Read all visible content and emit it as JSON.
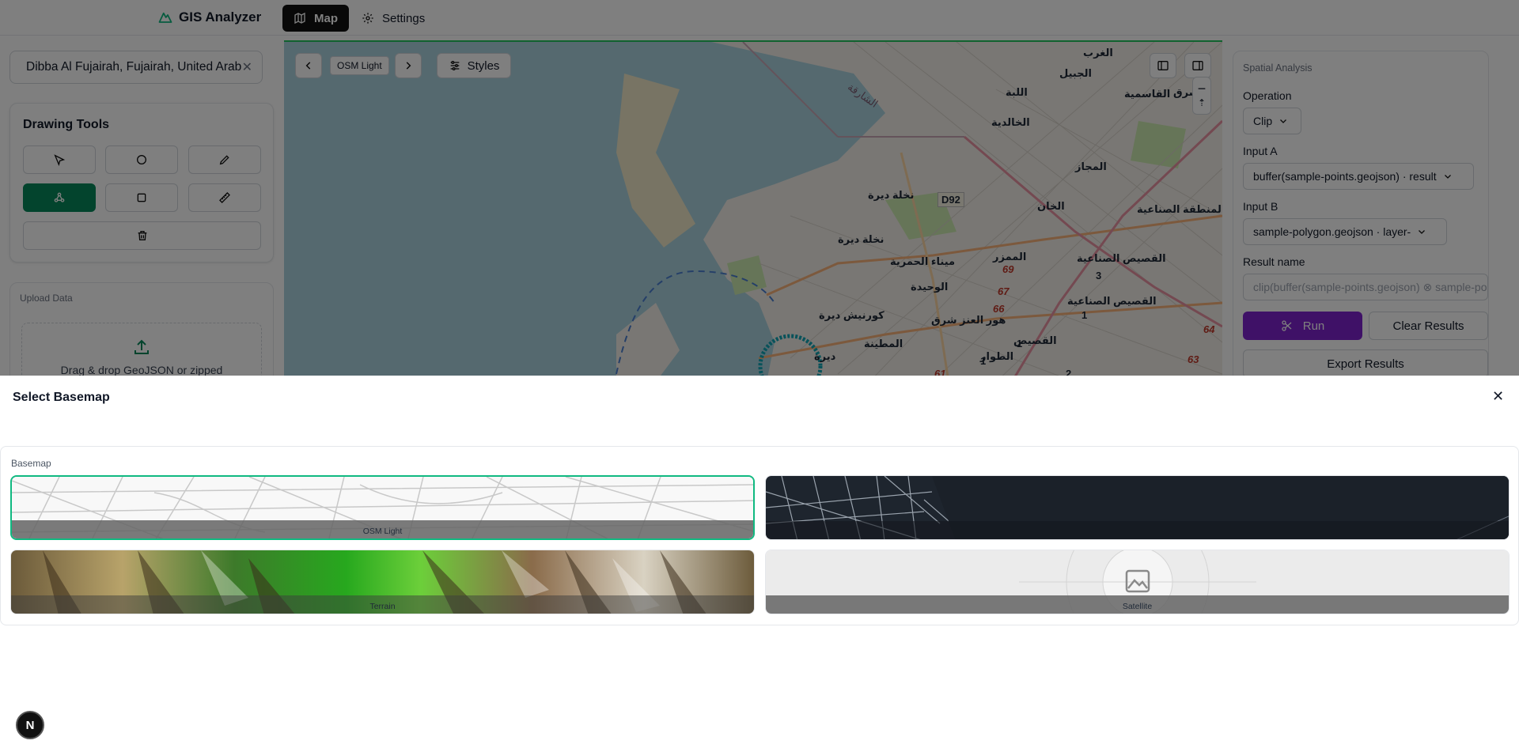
{
  "header": {
    "app_name": "GIS Analyzer",
    "nav": {
      "map_label": "Map",
      "settings_label": "Settings"
    }
  },
  "sidebar": {
    "search": {
      "value": "Dibba Al Fujairah, Fujairah, United Arab Emirates"
    },
    "drawing_tools": {
      "title": "Drawing Tools",
      "tools": [
        "select-icon",
        "circle-icon",
        "pencil-icon",
        "polygon-icon",
        "square-icon",
        "ruler-icon",
        "trash-icon"
      ],
      "active_tool": "polygon-icon"
    },
    "upload": {
      "label": "Upload Data",
      "drop_text": "Drag & drop GeoJSON or zipped"
    }
  },
  "map": {
    "basemap_chip": "OSM Light",
    "styles_label": "Styles",
    "place_labels": [
      "الغرب",
      "الجبيل",
      "اللبة",
      "القاسمية",
      "الخالدية",
      "المجاز",
      "الخان",
      "المنطقة الصناعية",
      "نخلة ديرة",
      "نخلة ديرة",
      "ميناء الحمرية",
      "الوحيدة",
      "الممزر",
      "القصيص الصناعية",
      "القصيص الصناعية",
      "كورنيش ديرة",
      "هور العنز شرق",
      "القصيص",
      "المطينة",
      "الطوار",
      "ديرة",
      "D92",
      "الشارقة",
      "الشرق"
    ],
    "route_numbers": [
      "69",
      "67",
      "66",
      "61",
      "64",
      "63",
      "3",
      "1",
      "1",
      "1",
      "2"
    ]
  },
  "analysis": {
    "title": "Spatial Analysis",
    "operation_label": "Operation",
    "operation_value": "Clip",
    "input_a_label": "Input A",
    "input_a_value": "buffer(sample-points.geojson) · result",
    "input_b_label": "Input B",
    "input_b_value": "sample-polygon.geojson · layer-",
    "result_name_label": "Result name",
    "result_name_placeholder": "clip(buffer(sample-points.geojson) ⊗ sample-polygon.geojson)",
    "run_label": "Run",
    "clear_label": "Clear Results",
    "export_label": "Export Results"
  },
  "basemap_dialog": {
    "title": "Select Basemap",
    "section_label": "Basemap",
    "options": [
      {
        "name": "OSM Light",
        "selected": true
      },
      {
        "name": "",
        "selected": false
      },
      {
        "name": "Terrain",
        "selected": false
      },
      {
        "name": "Satellite",
        "selected": false
      }
    ]
  },
  "dev_badge": "N",
  "colors": {
    "accent_green": "#07885a",
    "run_purple": "#7e22ce",
    "selected_border": "#10b981",
    "water": "#aad3df"
  }
}
